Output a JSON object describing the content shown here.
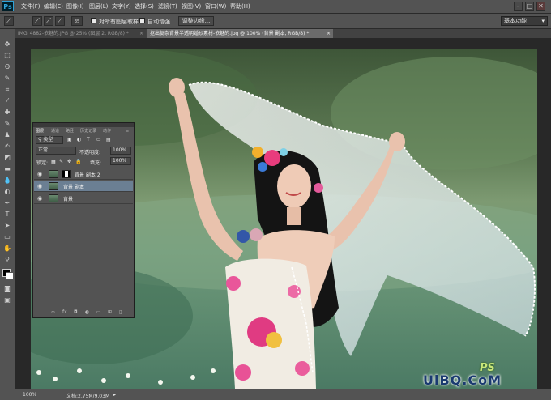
{
  "app": {
    "logo": "Ps"
  },
  "menu": [
    "文件(F)",
    "编辑(E)",
    "图像(I)",
    "图层(L)",
    "文字(Y)",
    "选择(S)",
    "滤镜(T)",
    "视图(V)",
    "窗口(W)",
    "帮助(H)"
  ],
  "window_controls": {
    "minimize": "–",
    "maximize": "□",
    "close": "✕"
  },
  "options_bar": {
    "brush_size": "35",
    "sample_all_layers_label": "对所有图层取样",
    "auto_enhance_label": "自动增强",
    "refine_edge_label": "调整边缘...",
    "workspace_label": "基本功能"
  },
  "tabs": [
    {
      "label": "IMG_4882-依魅的.JPG @ 25% (图层 2, RGB/8) *",
      "active": false,
      "close": "×"
    },
    {
      "label": "抠出复杂背景半透明婚纱素材-依魅的.jpg @ 100% (背景 副本, RGB/8) *",
      "active": true,
      "close": "×"
    }
  ],
  "layers_panel": {
    "tabs": [
      "图层",
      "通道",
      "路径",
      "历史记录",
      "动作"
    ],
    "filter_label": "类型",
    "blend_mode": "正常",
    "opacity_label": "不透明度:",
    "opacity_value": "100%",
    "lock_label": "锁定:",
    "fill_label": "填充:",
    "fill_value": "100%",
    "layers": [
      {
        "name": "背景 副本 2",
        "selected": false,
        "has_mask": true
      },
      {
        "name": "背景 副本",
        "selected": true,
        "has_mask": false
      },
      {
        "name": "背景",
        "selected": false,
        "has_mask": false
      }
    ],
    "bottom_icons": [
      "link-icon",
      "fx-icon",
      "mask-icon",
      "adjustment-icon",
      "group-icon",
      "new-layer-icon",
      "trash-icon"
    ]
  },
  "status": {
    "zoom": "100%",
    "doc_info": "文档:2.75M/9.03M"
  },
  "watermark": {
    "ps_text": "PS",
    "site_text": "UiBQ.CoM"
  }
}
